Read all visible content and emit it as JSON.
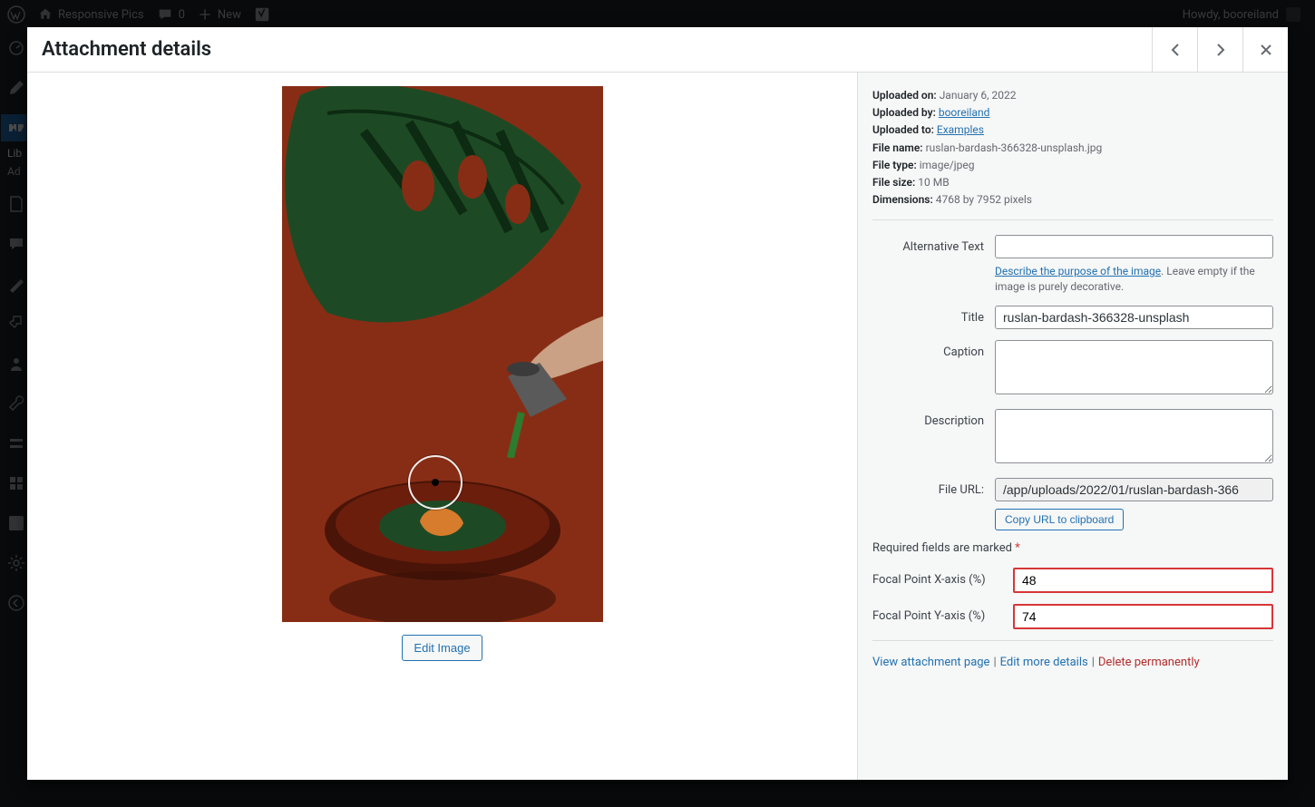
{
  "adminbar": {
    "site_name": "Responsive Pics",
    "comment_count": "0",
    "new_label": "New",
    "howdy": "Howdy, booreiland"
  },
  "leftnav": {
    "labels": {
      "library": "Lib",
      "add": "Ad"
    }
  },
  "modal": {
    "title": "Attachment details"
  },
  "meta": {
    "uploaded_on_label": "Uploaded on:",
    "uploaded_on": "January 6, 2022",
    "uploaded_by_label": "Uploaded by:",
    "uploaded_by": "booreiland",
    "uploaded_to_label": "Uploaded to:",
    "uploaded_to": "Examples",
    "file_name_label": "File name:",
    "file_name": "ruslan-bardash-366328-unsplash.jpg",
    "file_type_label": "File type:",
    "file_type": "image/jpeg",
    "file_size_label": "File size:",
    "file_size": "10 MB",
    "dimensions_label": "Dimensions:",
    "dimensions": "4768 by 7952 pixels"
  },
  "fields": {
    "alt_label": "Alternative Text",
    "alt_value": "",
    "alt_help_link": "Describe the purpose of the image",
    "alt_help_rest": ". Leave empty if the image is purely decorative.",
    "title_label": "Title",
    "title_value": "ruslan-bardash-366328-unsplash",
    "caption_label": "Caption",
    "caption_value": "",
    "description_label": "Description",
    "description_value": "",
    "file_url_label": "File URL:",
    "file_url_value": "/app/uploads/2022/01/ruslan-bardash-366",
    "copy_btn": "Copy URL to clipboard"
  },
  "required_note": "Required fields are marked",
  "required_ast": "*",
  "focal": {
    "x_label": "Focal Point X-axis (%)",
    "x_value": "48",
    "y_label": "Focal Point Y-axis (%)",
    "y_value": "74"
  },
  "edit_image_btn": "Edit Image",
  "bottom_links": {
    "view": "View attachment page",
    "edit": "Edit more details",
    "delete": "Delete permanently"
  }
}
